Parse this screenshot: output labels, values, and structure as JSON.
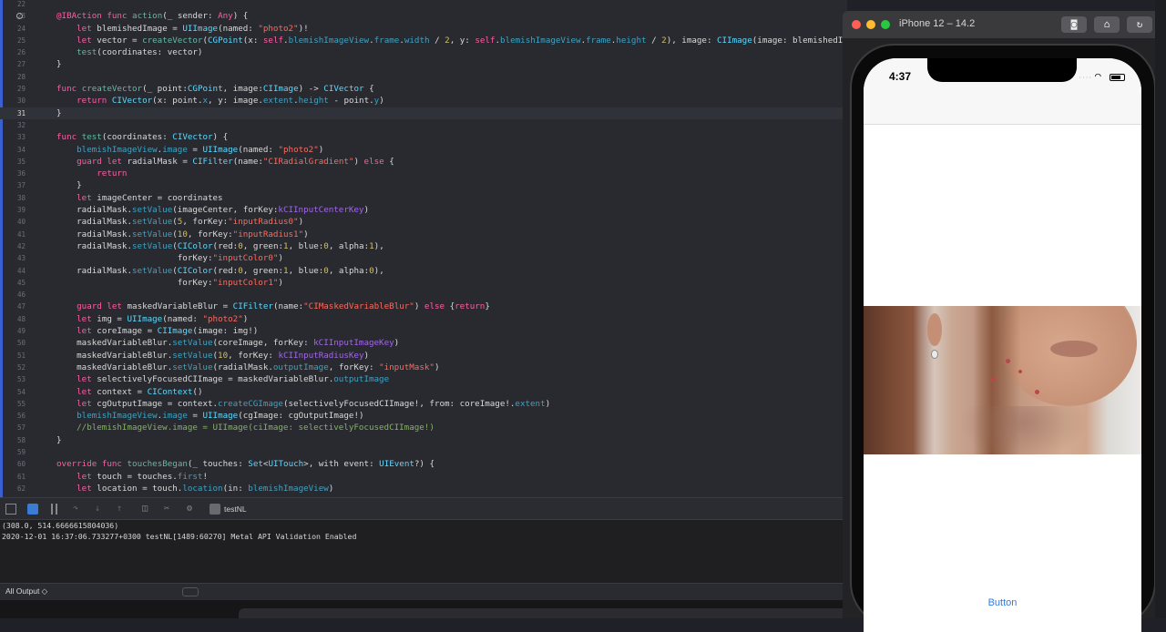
{
  "editor": {
    "current_line": 31,
    "lines": [
      {
        "n": 22,
        "html": ""
      },
      {
        "n": 23,
        "html": "<span class='k'>@IBAction</span> <span class='k'>func</span> <span class='f'>action</span>(_ sender: <span class='k'>Any</span>) {"
      },
      {
        "n": 24,
        "html": "    <span class='k'>let</span> blemishedImage = <span class='t'>UIImage</span>(named: <span class='s'>\"photo2\"</span>)!"
      },
      {
        "n": 25,
        "html": "    <span class='k'>let</span> vector = <span class='f'>createVector</span>(<span class='t'>CGPoint</span>(x: <span class='k'>self</span>.<span class='bl'>blemishImageView</span>.<span class='bl'>frame</span>.<span class='bl'>width</span> / <span class='n'>2</span>, y: <span class='k'>self</span>.<span class='bl'>blemishImageView</span>.<span class='bl'>frame</span>.<span class='bl'>height</span> / <span class='n'>2</span>), image: <span class='t'>CIImage</span>(image: blemishedImage))"
      },
      {
        "n": 26,
        "html": "    <span class='f'>test</span>(coordinates: vector)"
      },
      {
        "n": 27,
        "html": "}"
      },
      {
        "n": 28,
        "html": ""
      },
      {
        "n": 29,
        "html": "<span class='k'>func</span> <span class='f'>createVector</span>(_ point:<span class='t'>CGPoint</span>, image:<span class='t'>CIImage</span>) -&gt; <span class='t'>CIVector</span> {"
      },
      {
        "n": 30,
        "html": "    <span class='k'>return</span> <span class='t'>CIVector</span>(x: point.<span class='bl'>x</span>, y: image.<span class='bl'>extent</span>.<span class='bl'>height</span> - point.<span class='bl'>y</span>)"
      },
      {
        "n": 31,
        "html": "}"
      },
      {
        "n": 32,
        "html": ""
      },
      {
        "n": 33,
        "html": "<span class='k'>func</span> <span class='f'>test</span>(coordinates: <span class='t'>CIVector</span>) {"
      },
      {
        "n": 34,
        "html": "    <span class='bl'>blemishImageView</span>.<span class='bl'>image</span> = <span class='t'>UIImage</span>(named: <span class='s'>\"photo2\"</span>)"
      },
      {
        "n": 35,
        "html": "    <span class='k'>guard</span> <span class='k'>let</span> radialMask = <span class='t'>CIFilter</span>(name:<span class='s'>\"CIRadialGradient\"</span>) <span class='k'>else</span> {"
      },
      {
        "n": 36,
        "html": "        <span class='k'>return</span>"
      },
      {
        "n": 37,
        "html": "    }"
      },
      {
        "n": 38,
        "html": "    <span class='k'>let</span> imageCenter = coordinates"
      },
      {
        "n": 39,
        "html": "    radialMask.<span class='bl'>setValue</span>(imageCenter, forKey:<span class='p'>kCIInputCenterKey</span>)"
      },
      {
        "n": 40,
        "html": "    radialMask.<span class='bl'>setValue</span>(<span class='n'>5</span>, forKey:<span class='s'>\"inputRadius0\"</span>)"
      },
      {
        "n": 41,
        "html": "    radialMask.<span class='bl'>setValue</span>(<span class='n'>10</span>, forKey:<span class='s'>\"inputRadius1\"</span>)"
      },
      {
        "n": 42,
        "html": "    radialMask.<span class='bl'>setValue</span>(<span class='t'>CIColor</span>(red:<span class='n'>0</span>, green:<span class='n'>1</span>, blue:<span class='n'>0</span>, alpha:<span class='n'>1</span>),"
      },
      {
        "n": 43,
        "html": "                        forKey:<span class='s'>\"inputColor0\"</span>)"
      },
      {
        "n": 44,
        "html": "    radialMask.<span class='bl'>setValue</span>(<span class='t'>CIColor</span>(red:<span class='n'>0</span>, green:<span class='n'>1</span>, blue:<span class='n'>0</span>, alpha:<span class='n'>0</span>),"
      },
      {
        "n": 45,
        "html": "                        forKey:<span class='s'>\"inputColor1\"</span>)"
      },
      {
        "n": 46,
        "html": ""
      },
      {
        "n": 47,
        "html": "    <span class='k'>guard</span> <span class='k'>let</span> maskedVariableBlur = <span class='t'>CIFilter</span>(name:<span class='s'>\"CIMaskedVariableBlur\"</span>) <span class='k'>else</span> {<span class='k'>return</span>}"
      },
      {
        "n": 48,
        "html": "    <span class='k'>let</span> img = <span class='t'>UIImage</span>(named: <span class='s'>\"photo2\"</span>)"
      },
      {
        "n": 49,
        "html": "    <span class='k'>let</span> coreImage = <span class='t'>CIImage</span>(image: img!)"
      },
      {
        "n": 50,
        "html": "    maskedVariableBlur.<span class='bl'>setValue</span>(coreImage, forKey: <span class='p'>kCIInputImageKey</span>)"
      },
      {
        "n": 51,
        "html": "    maskedVariableBlur.<span class='bl'>setValue</span>(<span class='n'>10</span>, forKey: <span class='p'>kCIInputRadiusKey</span>)"
      },
      {
        "n": 52,
        "html": "    maskedVariableBlur.<span class='bl'>setValue</span>(radialMask.<span class='bl'>outputImage</span>, forKey: <span class='s'>\"inputMask\"</span>)"
      },
      {
        "n": 53,
        "html": "    <span class='k'>let</span> selectivelyFocusedCIImage = maskedVariableBlur.<span class='bl'>outputImage</span>"
      },
      {
        "n": 54,
        "html": "    <span class='k'>let</span> context = <span class='t'>CIContext</span>()"
      },
      {
        "n": 55,
        "html": "    <span class='k'>let</span> cgOutputImage = context.<span class='bl'>createCGImage</span>(selectivelyFocusedCIImage!, from: coreImage!.<span class='bl'>extent</span>)"
      },
      {
        "n": 56,
        "html": "    <span class='bl'>blemishImageView</span>.<span class='bl'>image</span> = <span class='t'>UIImage</span>(cgImage: cgOutputImage!)"
      },
      {
        "n": 57,
        "html": "    <span class='g'>//blemishImageView.image = UIImage(ciImage: selectivelyFocusedCIImage!)</span>"
      },
      {
        "n": 58,
        "html": "}"
      },
      {
        "n": 59,
        "html": ""
      },
      {
        "n": 60,
        "html": "<span class='k'>override</span> <span class='k'>func</span> <span class='f'>touchesBegan</span>(_ touches: <span class='t'>Set</span>&lt;<span class='t'>UITouch</span>&gt;, with event: <span class='t'>UIEvent</span>?) {"
      },
      {
        "n": 61,
        "html": "    <span class='k'>let</span> touch = touches.<span class='bl'>first</span>!"
      },
      {
        "n": 62,
        "html": "    <span class='k'>let</span> location = touch.<span class='bl'>location</span>(in: <span class='bl'>blemishImageView</span>)"
      }
    ]
  },
  "debug_bar": {
    "target": "testNL"
  },
  "console": {
    "lines": [
      "(308.0, 514.6666615804036)",
      "2020-12-01 16:37:06.733277+0300 testNL[1489:60270] Metal API Validation Enabled"
    ],
    "filter": "All Output ◇"
  },
  "simulator": {
    "title": "iPhone 12 – 14.2",
    "time": "4:37",
    "button_label": "Button",
    "icons": [
      "screenshot-icon",
      "home-icon",
      "rotate-icon"
    ]
  }
}
